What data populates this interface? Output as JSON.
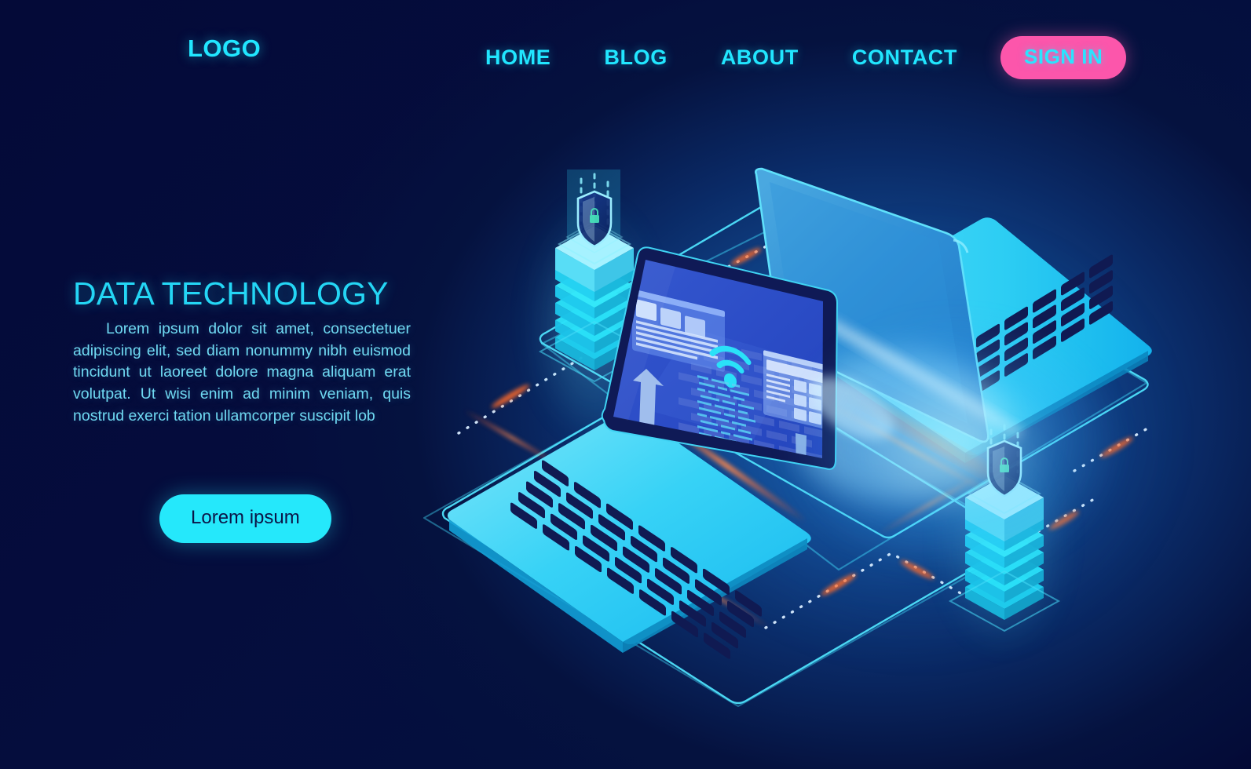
{
  "page": {
    "background_dark": "#030733",
    "accent_cyan": "#21e6ff",
    "accent_pink": "#fc56ab",
    "accent_blue": "#1b63b4"
  },
  "nav": {
    "logo": "LOGO",
    "links": [
      {
        "label": "HOME",
        "name": "nav-link-home"
      },
      {
        "label": "BLOG",
        "name": "nav-link-blog"
      },
      {
        "label": "ABOUT",
        "name": "nav-link-about"
      },
      {
        "label": "CONTACT",
        "name": "nav-link-contact"
      }
    ],
    "signin_label": "SIGN IN",
    "signin_bg": "#fc56ab",
    "signin_text_color": "#2ae4ff"
  },
  "hero": {
    "headline": "DATA TECHNOLOGY",
    "body": "Lorem ipsum dolor sit amet, consectetuer adipiscing elit, sed diam nonummy nibh euismod tincidunt ut laoreet dolore magna aliquam erat volutpat. Ut wisi enim ad minim veniam, quis nostrud exerci tation ullamcorper suscipit lob",
    "cta_label": "Lorem ipsum",
    "cta_bg": "#25e8fb",
    "cta_text_color": "#0b1547",
    "headline_color": "#24d6f5",
    "body_color": "#6fd9f2"
  },
  "illustration": {
    "description": "Isometric data technology scene: two laptops, two glowing server towers with shield hologram, dotted network connections",
    "laptop_front": {
      "name": "laptop-front",
      "screen_widgets": [
        "document-card",
        "up-arrow-icon",
        "bar-chart",
        "wifi-icon",
        "code-text-lines",
        "table-card",
        "down-arrow-icon",
        "user-profile-card",
        "fingerprint-radar-icon"
      ],
      "body_color": "#2fd8f5",
      "screen_color": "#2b4fc4"
    },
    "laptop_back": {
      "name": "laptop-back",
      "lid_color": "#2a8fd8",
      "body_color": "#2fd8f5"
    },
    "servers": [
      {
        "name": "server-tower-left",
        "layers": 6,
        "hologram": "shield-lock-icon"
      },
      {
        "name": "server-tower-right",
        "layers": 6,
        "hologram": "shield-lock-icon"
      }
    ],
    "connections": {
      "style": "dotted",
      "dot_color": "#cfe9ff",
      "glow_color": "#ff5a28"
    }
  }
}
